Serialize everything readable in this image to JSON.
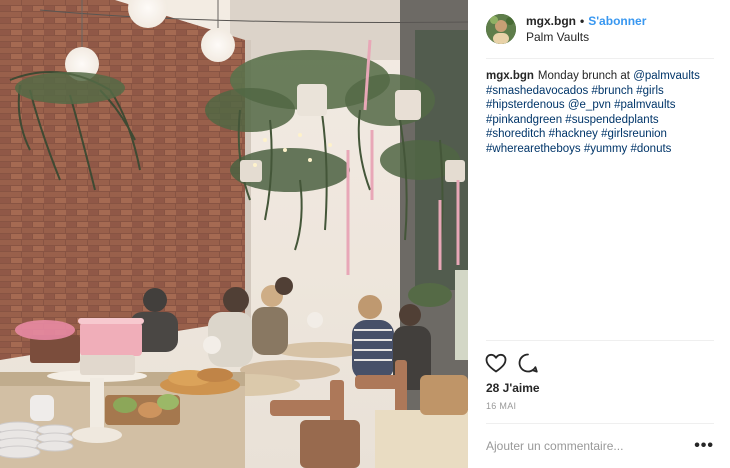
{
  "post": {
    "username": "mgx.bgn",
    "separator": "•",
    "follow_label": "S'abonner",
    "location": "Palm Vaults",
    "caption": {
      "username": "mgx.bgn",
      "text": "Monday brunch at",
      "mention": "@palmvaults",
      "tags": [
        "#smashedavocados",
        "#brunch",
        "#girls",
        "#hipsterdenous",
        "@e_pvn",
        "#palmvaults",
        "#pinkandgreen",
        "#suspendedplants",
        "#shoreditch",
        "#hackney",
        "#girlsreunion",
        "#wherearetheboys",
        "#yummy",
        "#donuts"
      ]
    },
    "likes": "28 J'aime",
    "date": "16 MAI",
    "comment_placeholder": "Ajouter un commentaire...",
    "more_label": "•••"
  },
  "icons": {
    "like": "heart-icon",
    "comment": "comment-icon",
    "more": "more-options-icon"
  },
  "colors": {
    "accent": "#3897f0",
    "link": "#003569",
    "text": "#262626",
    "muted": "#999999",
    "divider": "#efefef"
  }
}
